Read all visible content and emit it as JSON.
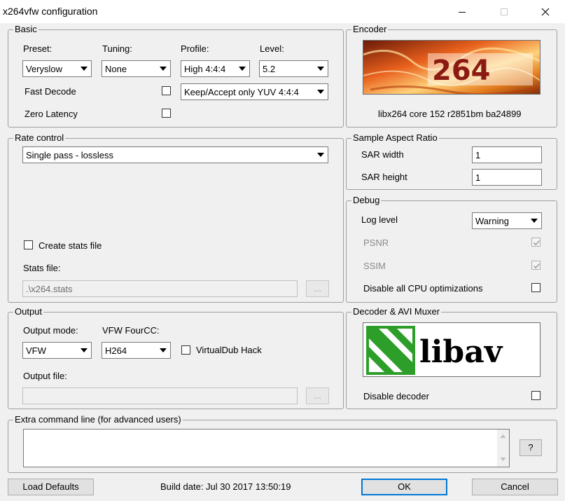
{
  "window": {
    "title": "x264vfw configuration",
    "controls": {
      "minimize_icon": "minimize-icon",
      "maximize_icon": "maximize-icon",
      "close_icon": "close-icon"
    }
  },
  "basic": {
    "title": "Basic",
    "preset": {
      "label": "Preset:",
      "value": "Veryslow"
    },
    "tuning": {
      "label": "Tuning:",
      "value": "None"
    },
    "profile": {
      "label": "Profile:",
      "value": "High 4:4:4"
    },
    "level": {
      "label": "Level:",
      "value": "5.2"
    },
    "colorspace": {
      "value": "Keep/Accept only YUV 4:4:4"
    },
    "fast_decode": {
      "label": "Fast Decode",
      "checked": false
    },
    "zero_latency": {
      "label": "Zero Latency",
      "checked": false
    }
  },
  "encoder": {
    "title": "Encoder",
    "logo_text": "264",
    "version": "libx264 core 152 r2851bm ba24899"
  },
  "rate_control": {
    "title": "Rate control",
    "mode": "Single pass - lossless",
    "create_stats": {
      "label": "Create stats file",
      "checked": false
    },
    "stats_file_label": "Stats file:",
    "stats_file_value": ".\\x264.stats",
    "browse_label": "..."
  },
  "sar": {
    "title": "Sample Aspect Ratio",
    "width_label": "SAR width",
    "width_value": "1",
    "height_label": "SAR height",
    "height_value": "1"
  },
  "debug": {
    "title": "Debug",
    "log_level_label": "Log level",
    "log_level_value": "Warning",
    "psnr": {
      "label": "PSNR",
      "checked": true
    },
    "ssim": {
      "label": "SSIM",
      "checked": true
    },
    "disable_cpu": {
      "label": "Disable all CPU optimizations",
      "checked": false
    }
  },
  "output": {
    "title": "Output",
    "mode_label": "Output mode:",
    "mode_value": "VFW",
    "fourcc_label": "VFW FourCC:",
    "fourcc_value": "H264",
    "vdub_hack": {
      "label": "VirtualDub Hack",
      "checked": false
    },
    "file_label": "Output file:",
    "file_value": "",
    "browse_label": "..."
  },
  "decoder": {
    "title": "Decoder & AVI Muxer",
    "logo_text": "libav",
    "disable_decoder": {
      "label": "Disable decoder",
      "checked": false
    }
  },
  "extra": {
    "title": "Extra command line (for advanced users)",
    "value": "",
    "help_label": "?"
  },
  "footer": {
    "load_defaults": "Load Defaults",
    "build_date": "Build date: Jul 30 2017 13:50:19",
    "ok": "OK",
    "cancel": "Cancel"
  },
  "colors": {
    "dialog_bg": "#f0f0f0",
    "accent": "#0078d7",
    "logo_green": "#2e9e2a",
    "logo_flame": "#e8601c"
  }
}
